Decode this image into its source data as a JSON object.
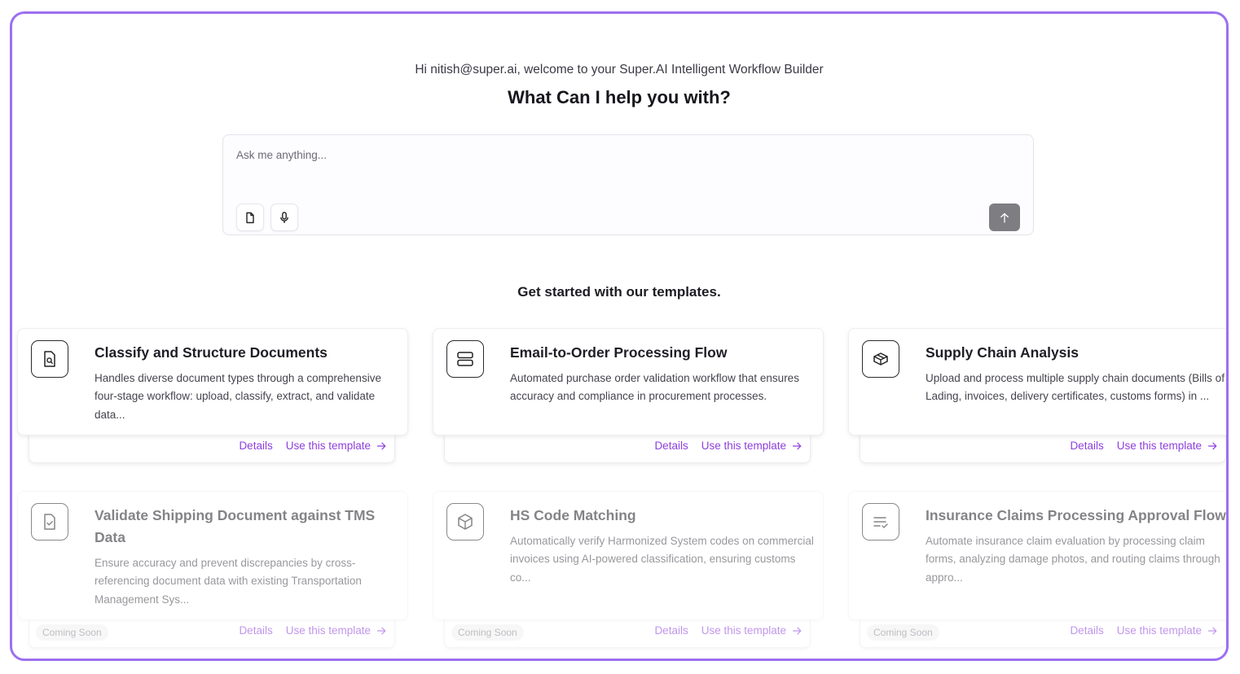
{
  "header": {
    "welcome": "Hi nitish@super.ai, welcome to your Super.AI Intelligent Workflow Builder",
    "headline": "What Can I help you with?"
  },
  "prompt": {
    "placeholder": "Ask me anything...",
    "value": ""
  },
  "templates_section": {
    "title": "Get started with our templates."
  },
  "templates": [
    {
      "icon": "document-search-icon",
      "title": "Classify and Structure Documents",
      "description": "Handles diverse document types through a comprehensive four-stage workflow: upload, classify, extract, and validate data...",
      "details_label": "Details",
      "use_label": "Use this template",
      "badge": ""
    },
    {
      "icon": "server-stack-icon",
      "title": "Email-to-Order Processing Flow",
      "description": "Automated purchase order validation workflow that ensures accuracy and compliance in procurement processes.",
      "details_label": "Details",
      "use_label": "Use this template",
      "badge": ""
    },
    {
      "icon": "package-icon",
      "title": "Supply Chain Analysis",
      "description": "Upload and process multiple supply chain documents (Bills of Lading, invoices, delivery certificates, customs forms) in ...",
      "details_label": "Details",
      "use_label": "Use this template",
      "badge": ""
    },
    {
      "icon": "document-check-icon",
      "title": "Validate Shipping Document against TMS Data",
      "description": "Ensure accuracy and prevent discrepancies by cross-referencing document data with existing Transportation Management Sys...",
      "details_label": "Details",
      "use_label": "Use this template",
      "badge": "Coming Soon"
    },
    {
      "icon": "cube-icon",
      "title": "HS Code Matching",
      "description": "Automatically verify Harmonized System codes on commercial invoices using AI-powered classification, ensuring customs co...",
      "details_label": "Details",
      "use_label": "Use this template",
      "badge": "Coming Soon"
    },
    {
      "icon": "list-check-icon",
      "title": "Insurance Claims Processing Approval Flow",
      "description": "Automate insurance claim evaluation by processing claim forms, analyzing damage photos, and routing claims through appro...",
      "details_label": "Details",
      "use_label": "Use this template",
      "badge": "Coming Soon"
    }
  ],
  "colors": {
    "frame_border": "#9d6ff0",
    "link": "#8e3fdc",
    "send_button": "#7d7d82"
  }
}
